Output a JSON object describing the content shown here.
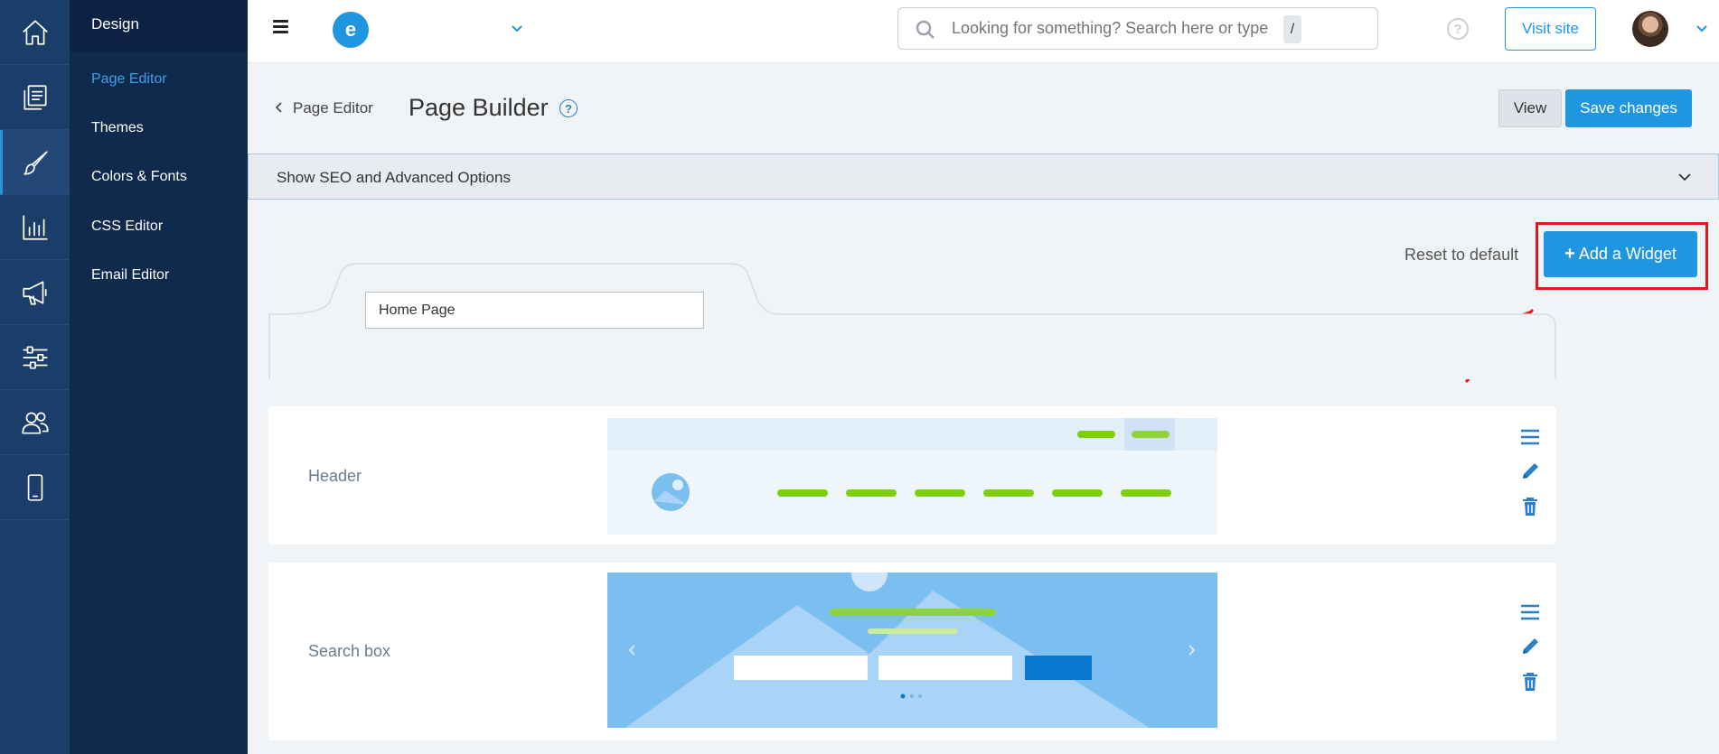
{
  "colors": {
    "accent": "#2196e0",
    "rail": "#1b3d6a",
    "submenu": "#102a4d",
    "highlight": "#e8141c",
    "preview_green": "#7dce0d",
    "preview_blue": "#7bbef0"
  },
  "rail": {
    "items": [
      {
        "icon": "home-icon"
      },
      {
        "icon": "pages-icon"
      },
      {
        "icon": "brush-icon",
        "active": true
      },
      {
        "icon": "chart-icon"
      },
      {
        "icon": "megaphone-icon"
      },
      {
        "icon": "sliders-icon"
      },
      {
        "icon": "users-icon"
      },
      {
        "icon": "mobile-icon"
      }
    ]
  },
  "submenu": {
    "title": "Design",
    "items": [
      {
        "label": "Page Editor",
        "active": true
      },
      {
        "label": "Themes"
      },
      {
        "label": "Colors & Fonts"
      },
      {
        "label": "CSS Editor"
      },
      {
        "label": "Email Editor"
      }
    ]
  },
  "topbar": {
    "logo_letter": "e",
    "search_placeholder": "Looking for something? Search here or type",
    "search_shortcut": "/",
    "help": "?",
    "visit_label": "Visit site"
  },
  "page": {
    "back_label": "Page Editor",
    "title": "Page Builder",
    "help": "?",
    "view_label": "View",
    "save_label": "Save changes"
  },
  "seo": {
    "label": "Show SEO and Advanced Options"
  },
  "widgets_area": {
    "reset_label": "Reset to default",
    "add_label": "Add a Widget",
    "add_plus": "+",
    "tab_value": "Home Page"
  },
  "widgets": [
    {
      "name": "Header"
    },
    {
      "name": "Search box"
    }
  ]
}
